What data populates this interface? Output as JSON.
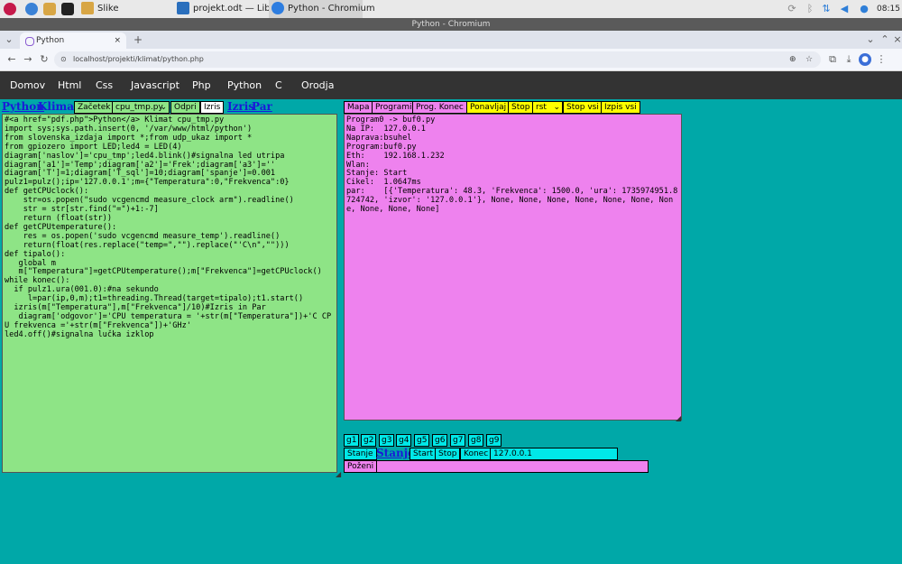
{
  "taskbar": {
    "apps": [
      {
        "label": "Slike"
      },
      {
        "label": "projekt.odt — LibreOf..."
      },
      {
        "label": "Python - Chromium"
      }
    ],
    "clock": "08:15"
  },
  "window_title": "Python - Chromium",
  "browser": {
    "tab_title": "Python",
    "new_tab": "+",
    "url": "localhost/projekti/klimat/python.php"
  },
  "site_menu": [
    "Domov",
    "Html",
    "Css",
    "Javascript",
    "Php",
    "Python",
    "C",
    "Orodja"
  ],
  "left_toolbar": {
    "python_link": "Python",
    "klimat_label": "Klimat",
    "zacetek": "Začetek",
    "file_select": "cpu_tmp.py",
    "odpri": "Odpri",
    "izris_btn": "Izris",
    "izris_link": "Izris",
    "par_link": "Par"
  },
  "code": "#<a href=\"pdf.php\">Python</a> Klimat cpu_tmp.py\nimport sys;sys.path.insert(0, '/var/www/html/python')\nfrom slovenska_izdaja import *;from udp_ukaz import *\nfrom gpiozero import LED;led4 = LED(4)\ndiagram['naslov']='cpu_tmp';led4.blink()#signalna led utripa\ndiagram['a1']='Temp';diagram['a2']='Frek';diagram['a3']=''\ndiagram['T']=1;diagram['T_sql']=10;diagram['spanje']=0.001\npulz1=pulz();ip='127.0.0.1';m={\"Temperatura\":0,\"Frekvenca\":0}\ndef getCPUclock():\n    str=os.popen(\"sudo vcgencmd measure_clock arm\").readline()\n    str = str[str.find(\"=\")+1:-7]\n    return (float(str))\ndef getCPUtemperature():\n    res = os.popen('sudo vcgencmd measure_temp').readline()\n    return(float(res.replace(\"temp=\",\"\").replace(\"'C\\n\",\"\")))\ndef tipalo():\n   global m\n   m[\"Temperatura\"]=getCPUtemperature();m[\"Frekvenca\"]=getCPUclock()\nwhile konec():\n  if pulz1.ura(001.0):#na sekundo\n     l=par(ip,0,m);t1=threading.Thread(target=tipalo);t1.start()\n  izris(m[\"Temperatura\"],m[\"Frekvenca\"]/10)#Izris in Par\n   diagram['odgovor']='CPU temperatura = '+str(m[\"Temperatura\"])+'C CPU frekvenca ='+str(m[\"Frekvenca\"])+'GHz'\nled4.off()#signalna lučka izklop",
  "right_toolbar": {
    "mapa": "Mapa",
    "programi": "Programi",
    "prog_konec": "Prog. Konec",
    "ponavljaj": "Ponavljaj",
    "stop": "Stop",
    "rst_select": "rst",
    "stop_vsi": "Stop vsi",
    "izpis_vsi": "Izpis vsi"
  },
  "output": "Program0 -> buf0.py\nNa IP:  127.0.0.1\nNaprava:bsuhel\nProgram:buf0.py\nEth:    192.168.1.232\nWlan:\nStanje: Start\nCikel:  1.0647ms\npar:    [{'Temperatura': 48.3, 'Frekvenca': 1500.0, 'ura': 1735974951.8724742, 'izvor': '127.0.0.1'}, None, None, None, None, None, None, None, None, None, None]",
  "g_buttons": [
    "g1",
    "g2",
    "g3",
    "g4",
    "g5",
    "g6",
    "g7",
    "g8",
    "g9"
  ],
  "status_row": {
    "stanje_btn": "Stanje",
    "stanje_link": "Stanje",
    "start": "Start",
    "stop": "Stop",
    "konec": "Konec",
    "ip_value": "127.0.0.1"
  },
  "pozeni": "Poženi",
  "colors": {
    "page_bg": "#00a8a8",
    "code_bg": "#8ee486",
    "output_bg": "#ee82ee",
    "accent_yellow": "#ffff00",
    "accent_cyan": "#00e8e8",
    "menu_bg": "#333333"
  }
}
